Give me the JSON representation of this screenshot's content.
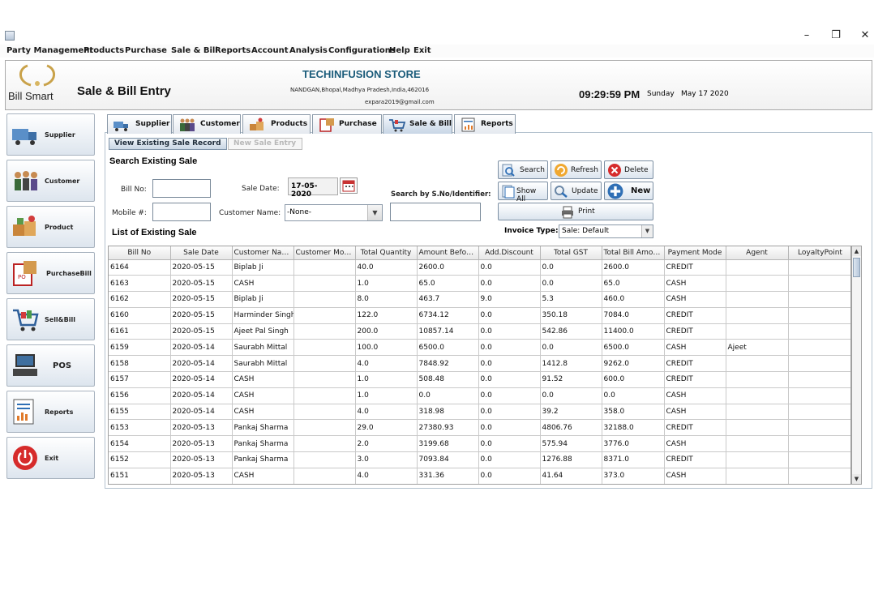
{
  "menu": [
    "Party Management",
    "Products",
    "Purchase",
    "Sale & Bill",
    "Reports",
    "Account",
    "Analysis",
    "Configurations",
    "Help",
    "Exit"
  ],
  "window": {
    "minimize": "–",
    "restore": "❐",
    "close": "✕"
  },
  "header": {
    "brand": "Bill Smart",
    "page_title": "Sale & Bill Entry",
    "store_name": "TECHINFUSION STORE",
    "store_address": "NANDGAN,Bhopal,Madhya Pradesh,India,462016",
    "store_email": "expara2019@gmail.com",
    "time": "09:29:59 PM",
    "day": "Sunday",
    "date": "May 17 2020"
  },
  "sidebar": [
    {
      "label": "Supplier",
      "icon": "truck-icon"
    },
    {
      "label": "Customer",
      "icon": "people-icon"
    },
    {
      "label": "Product",
      "icon": "boxes-icon"
    },
    {
      "label": "PurchaseBill",
      "icon": "purchase-order-icon"
    },
    {
      "label": "Sell&Bill",
      "icon": "shopping-cart-icon"
    },
    {
      "label": "POS",
      "icon": "pos-terminal-icon"
    },
    {
      "label": "Reports",
      "icon": "report-icon"
    },
    {
      "label": "Exit",
      "icon": "power-icon"
    }
  ],
  "top_tabs": [
    {
      "label": "Supplier",
      "icon": "truck-icon"
    },
    {
      "label": "Customer",
      "icon": "people-icon"
    },
    {
      "label": "Products",
      "icon": "boxes-icon"
    },
    {
      "label": "Purchase",
      "icon": "purchase-order-icon"
    },
    {
      "label": "Sale & Bill",
      "icon": "shopping-cart-icon",
      "active": true
    },
    {
      "label": "Reports",
      "icon": "report-icon"
    }
  ],
  "sub_tabs": {
    "view": "View Existing Sale Record",
    "new": "New Sale Entry"
  },
  "search": {
    "heading": "Search Existing Sale",
    "bill_no_label": "Bill No:",
    "bill_no_value": "",
    "mobile_label": "Mobile #:",
    "mobile_value": "",
    "sale_date_label": "Sale Date:",
    "sale_date_value": "17-05-2020",
    "customer_name_label": "Customer Name:",
    "customer_name_value": "-None-",
    "sno_label": "Search by S.No/Identifier:",
    "sno_value": ""
  },
  "buttons": {
    "search": "Search",
    "refresh": "Refresh",
    "delete": "Delete",
    "show_all": "Show All",
    "update": "Update",
    "new": "New",
    "print": "Print"
  },
  "invoice_type": {
    "label": "Invoice Type:",
    "value": "Sale: Default"
  },
  "list_heading": "List of Existing Sale",
  "table": {
    "columns": [
      "Bill No",
      "Sale Date",
      "Customer Name",
      "Customer Mobile",
      "Total Quantity",
      "Amount Before ...",
      "Add.Discount",
      "Total GST",
      "Total Bill Amount",
      "Payment Mode",
      "Agent",
      "LoyaltyPoint"
    ],
    "rows": [
      [
        "6164",
        "2020-05-15",
        "Biplab Ji",
        "",
        "40.0",
        "2600.0",
        "0.0",
        "0.0",
        "2600.0",
        "CREDIT",
        "",
        ""
      ],
      [
        "6163",
        "2020-05-15",
        "CASH",
        "",
        "1.0",
        "65.0",
        "0.0",
        "0.0",
        "65.0",
        "CASH",
        "",
        ""
      ],
      [
        "6162",
        "2020-05-15",
        "Biplab Ji",
        "",
        "8.0",
        "463.7",
        "9.0",
        "5.3",
        "460.0",
        "CASH",
        "",
        ""
      ],
      [
        "6160",
        "2020-05-15",
        "Harminder Singh",
        "",
        "122.0",
        "6734.12",
        "0.0",
        "350.18",
        "7084.0",
        "CREDIT",
        "",
        ""
      ],
      [
        "6161",
        "2020-05-15",
        "Ajeet Pal Singh",
        "",
        "200.0",
        "10857.14",
        "0.0",
        "542.86",
        "11400.0",
        "CREDIT",
        "",
        ""
      ],
      [
        "6159",
        "2020-05-14",
        "Saurabh Mittal",
        "",
        "100.0",
        "6500.0",
        "0.0",
        "0.0",
        "6500.0",
        "CASH",
        "Ajeet",
        ""
      ],
      [
        "6158",
        "2020-05-14",
        "Saurabh Mittal",
        "",
        "4.0",
        "7848.92",
        "0.0",
        "1412.8",
        "9262.0",
        "CREDIT",
        "",
        ""
      ],
      [
        "6157",
        "2020-05-14",
        "CASH",
        "",
        "1.0",
        "508.48",
        "0.0",
        "91.52",
        "600.0",
        "CREDIT",
        "",
        ""
      ],
      [
        "6156",
        "2020-05-14",
        "CASH",
        "",
        "1.0",
        "0.0",
        "0.0",
        "0.0",
        "0.0",
        "CASH",
        "",
        ""
      ],
      [
        "6155",
        "2020-05-14",
        "CASH",
        "",
        "4.0",
        "318.98",
        "0.0",
        "39.2",
        "358.0",
        "CASH",
        "",
        ""
      ],
      [
        "6153",
        "2020-05-13",
        "Pankaj Sharma",
        "",
        "29.0",
        "27380.93",
        "0.0",
        "4806.76",
        "32188.0",
        "CREDIT",
        "",
        ""
      ],
      [
        "6154",
        "2020-05-13",
        "Pankaj Sharma",
        "",
        "2.0",
        "3199.68",
        "0.0",
        "575.94",
        "3776.0",
        "CASH",
        "",
        ""
      ],
      [
        "6152",
        "2020-05-13",
        "Pankaj Sharma",
        "",
        "3.0",
        "7093.84",
        "0.0",
        "1276.88",
        "8371.0",
        "CREDIT",
        "",
        ""
      ],
      [
        "6151",
        "2020-05-13",
        "CASH",
        "",
        "4.0",
        "331.36",
        "0.0",
        "41.64",
        "373.0",
        "CASH",
        "",
        ""
      ]
    ]
  },
  "colors": {
    "store_name": "#1a5b7a",
    "accent_blue": "#2f6fb5",
    "exit_red": "#d62b2b"
  }
}
